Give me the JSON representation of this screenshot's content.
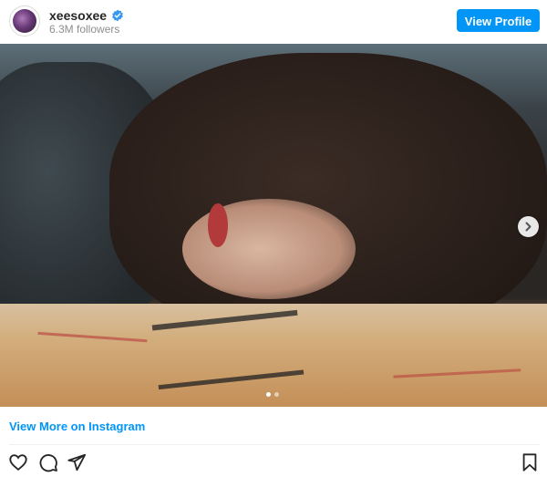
{
  "header": {
    "username": "xeesoxee",
    "followers": "6.3M followers",
    "view_profile_label": "View Profile"
  },
  "post": {
    "carousel": {
      "slide_count": 2,
      "active_index": 0
    }
  },
  "footer": {
    "view_more_label": "View More on Instagram"
  },
  "icons": {
    "verified": "verified-badge-icon",
    "next": "chevron-right-icon",
    "like": "heart-icon",
    "comment": "comment-icon",
    "share": "share-icon",
    "save": "bookmark-icon"
  },
  "colors": {
    "accent": "#0095f6",
    "text": "#262626",
    "muted": "#8e8e8e"
  }
}
